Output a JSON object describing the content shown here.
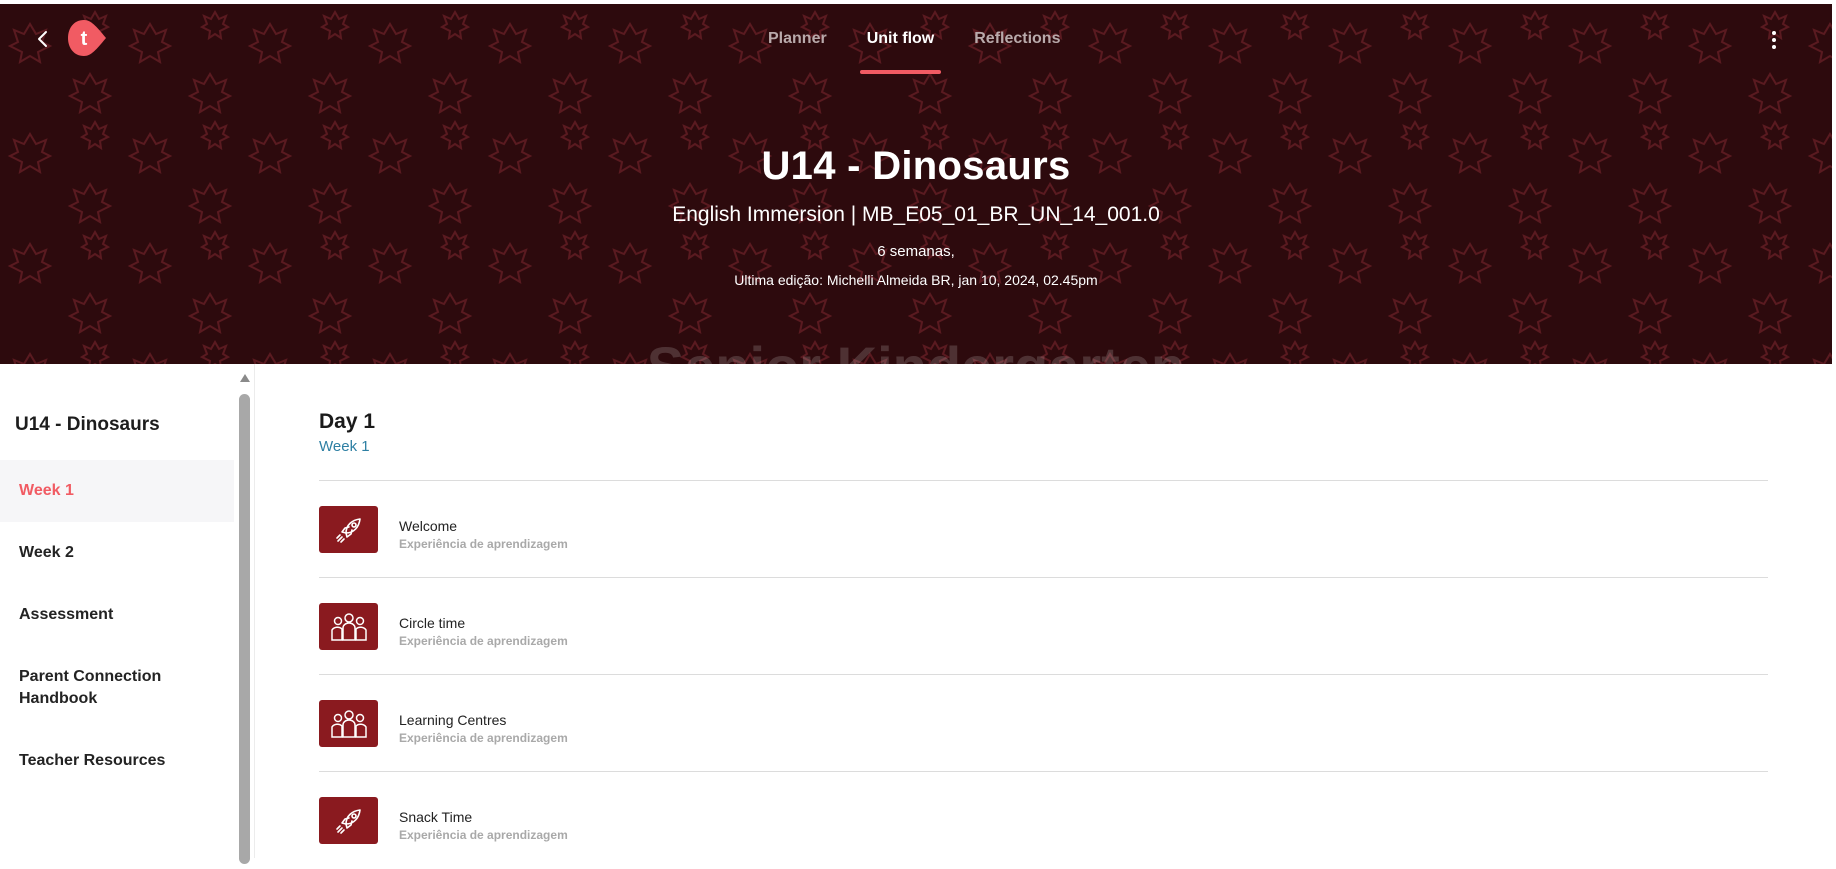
{
  "header": {
    "back_icon": "chevron-left-icon",
    "logo_letter": "t",
    "brand_color": "#f15b63",
    "banner_color": "#2d0a0d",
    "tabs": [
      {
        "label": "Planner",
        "active": false
      },
      {
        "label": "Unit flow",
        "active": true
      },
      {
        "label": "Reflections",
        "active": false
      }
    ],
    "more_icon": "more-vertical-icon",
    "ghost_text": "Senior Kindergarten"
  },
  "unit": {
    "title": "U14 - Dinosaurs",
    "subtitle": "English Immersion | MB_E05_01_BR_UN_14_001.0",
    "duration": "6 semanas,",
    "last_edit": "Ultima edição: Michelli Almeida BR, jan 10, 2024, 02.45pm"
  },
  "sidebar": {
    "title": "U14 - Dinosaurs",
    "items": [
      {
        "label": "Week 1",
        "active": true
      },
      {
        "label": "Week 2",
        "active": false
      },
      {
        "label": "Assessment",
        "active": false
      },
      {
        "label": "Parent Connection Handbook",
        "active": false
      },
      {
        "label": "Teacher Resources",
        "active": false
      }
    ]
  },
  "main": {
    "day_title": "Day 1",
    "day_week": "Week 1",
    "items": [
      {
        "name": "Welcome",
        "kind": "Experiência de aprendizagem",
        "icon": "rocket-icon"
      },
      {
        "name": "Circle time",
        "kind": "Experiência de aprendizagem",
        "icon": "group-icon"
      },
      {
        "name": "Learning Centres",
        "kind": "Experiência de aprendizagem",
        "icon": "group-icon"
      },
      {
        "name": "Snack Time",
        "kind": "Experiência de aprendizagem",
        "icon": "rocket-icon"
      }
    ]
  }
}
